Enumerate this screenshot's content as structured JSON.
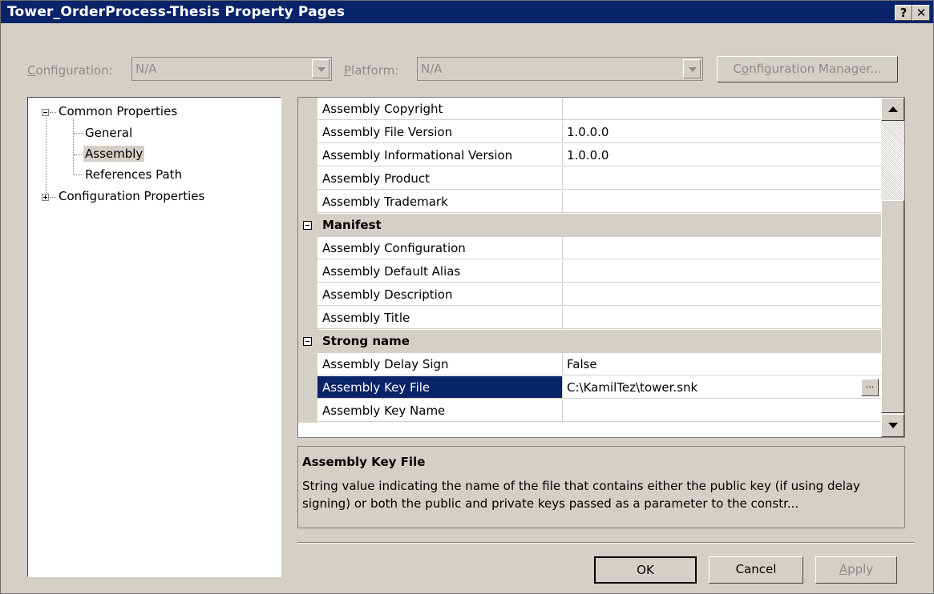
{
  "window": {
    "title": "Tower_OrderProcess-Thesis Property Pages",
    "help_label": "?",
    "close_label": "✕"
  },
  "toolbar": {
    "configuration_label_u": "C",
    "configuration_label_rest": "onfiguration:",
    "configuration_value": "N/A",
    "platform_label_u": "P",
    "platform_label_rest": "latform:",
    "platform_value": "N/A",
    "config_manager_label_pre": "C",
    "config_manager_label_u": "o",
    "config_manager_label_rest": "nfiguration Manager..."
  },
  "tree": {
    "common": "Common Properties",
    "general": "General",
    "assembly": "Assembly",
    "references": "References Path",
    "configuration": "Configuration Properties"
  },
  "grid": {
    "rows": [
      {
        "name": "Assembly Copyright",
        "value": ""
      },
      {
        "name": "Assembly File Version",
        "value": "1.0.0.0"
      },
      {
        "name": "Assembly Informational Version",
        "value": "1.0.0.0"
      },
      {
        "name": "Assembly Product",
        "value": ""
      },
      {
        "name": "Assembly Trademark",
        "value": ""
      },
      {
        "name": "Manifest",
        "value": ""
      },
      {
        "name": "Assembly Configuration",
        "value": ""
      },
      {
        "name": "Assembly Default Alias",
        "value": ""
      },
      {
        "name": "Assembly Description",
        "value": ""
      },
      {
        "name": "Assembly Title",
        "value": ""
      },
      {
        "name": "Strong name",
        "value": ""
      },
      {
        "name": "Assembly Delay Sign",
        "value": "False"
      },
      {
        "name": "Assembly Key File",
        "value": "C:\\KamilTez\\tower.snk"
      },
      {
        "name": "Assembly Key Name",
        "value": ""
      }
    ],
    "ellipsis": "..."
  },
  "description": {
    "title": "Assembly Key File",
    "text": "String value indicating the name of the file that contains either the public key (if using delay signing) or both the public and private keys passed as a parameter to the constr..."
  },
  "buttons": {
    "ok": "OK",
    "cancel": "Cancel",
    "apply_u": "A",
    "apply_rest": "pply"
  }
}
